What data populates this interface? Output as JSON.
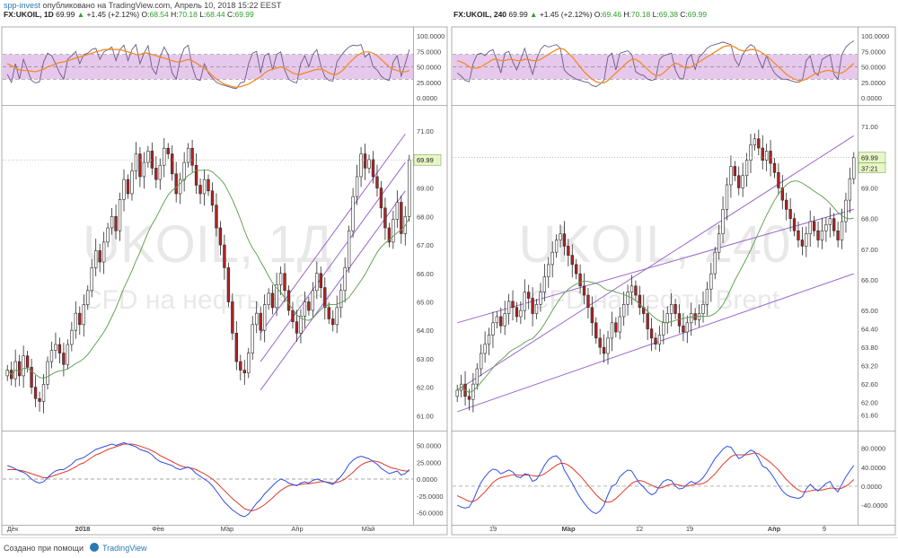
{
  "header": {
    "user": "spp-invest",
    "published_text": "опубликовано на TradingView.com, Апрель 10, 2018 15:22 EEST"
  },
  "footer": {
    "created_text": "Создано при помощи",
    "brand": "TradingView"
  },
  "colors": {
    "up": "#ffffff",
    "down": "#b22222",
    "wick": "#2a2a2a",
    "ma": "#5a9a4a",
    "channel": "#9966cc",
    "rsi_band": "#e6c8ec",
    "rsi_line": "#6b5a8a",
    "rsi_ma": "#f08c28",
    "macd_blue": "#2f4fe0",
    "macd_red": "#e0392b",
    "last_price_bg": "#e8f5c8"
  },
  "chart_data": [
    {
      "type": "candlestick",
      "symbol": "FX:UKOIL, 1D",
      "ohlc_line": {
        "symbol": "FX:UKOIL, 1D",
        "last": "69.99",
        "change": "+1.45 (+2.12%)",
        "O": "68.54",
        "H": "70.18",
        "L": "68.44",
        "C": "69.99"
      },
      "watermark": {
        "title": "UKOIL, 1Д",
        "subtitle": "CFD на нефть Brent"
      },
      "x_ticks": [
        "Дек",
        "2018",
        "Фев",
        "Мар",
        "Апр",
        "Май"
      ],
      "price_ticks": [
        "71.00",
        "70.00",
        "69.00",
        "68.00",
        "67.00",
        "66.00",
        "65.00",
        "64.00",
        "63.00",
        "62.00",
        "61.00"
      ],
      "ylim": [
        60.6,
        71.7
      ],
      "last_price_label": "69.99",
      "close": [
        62.6,
        62.3,
        62.9,
        62.4,
        63.1,
        62.7,
        62.0,
        61.6,
        61.5,
        62.1,
        62.9,
        63.3,
        63.5,
        63.2,
        62.8,
        63.5,
        64.0,
        64.6,
        64.2,
        64.9,
        65.4,
        66.2,
        66.8,
        66.4,
        67.1,
        67.6,
        68.0,
        67.5,
        68.6,
        69.3,
        68.8,
        69.6,
        70.2,
        69.4,
        69.9,
        70.3,
        69.7,
        69.3,
        69.8,
        70.4,
        70.2,
        69.5,
        68.8,
        69.3,
        69.9,
        70.4,
        69.8,
        69.1,
        68.8,
        69.3,
        68.9,
        68.4,
        67.6,
        67.0,
        66.2,
        65.0,
        63.9,
        62.9,
        62.6,
        62.5,
        63.2,
        64.2,
        64.6,
        64.0,
        64.9,
        65.3,
        64.8,
        65.6,
        66.0,
        65.4,
        64.7,
        64.3,
        63.9,
        64.5,
        65.0,
        64.7,
        65.4,
        66.0,
        65.5,
        64.8,
        64.4,
        64.2,
        64.8,
        65.4,
        66.2,
        67.5,
        68.7,
        69.4,
        70.2,
        69.7,
        70.0,
        69.4,
        69.0,
        68.3,
        67.6,
        67.1,
        67.9,
        68.5,
        67.4,
        68.0,
        69.99
      ],
      "ma_period": 20,
      "channel_lines": [
        {
          "x": [
            0,
            0
          ],
          "y": [
            0,
            0
          ]
        }
      ],
      "channel": [
        [
          61.9,
          68.9
        ],
        [
          62.9,
          69.9
        ],
        [
          63.9,
          70.9
        ]
      ],
      "channel_x": [
        63,
        99
      ],
      "rsi": {
        "ticks": [
          "100.0000",
          "75.0000",
          "50.0000",
          "25.0000",
          "0.0000"
        ],
        "ylim": [
          0,
          100
        ],
        "band": [
          30,
          70
        ],
        "values": [
          38,
          25,
          55,
          30,
          62,
          45,
          28,
          24,
          26,
          58,
          72,
          68,
          55,
          40,
          30,
          62,
          68,
          75,
          55,
          70,
          72,
          78,
          80,
          62,
          74,
          78,
          82,
          60,
          78,
          85,
          60,
          78,
          86,
          55,
          72,
          84,
          48,
          38,
          66,
          82,
          70,
          40,
          30,
          62,
          80,
          85,
          50,
          30,
          28,
          55,
          40,
          32,
          25,
          22,
          20,
          18,
          16,
          15,
          24,
          26,
          55,
          72,
          75,
          40,
          68,
          72,
          45,
          70,
          74,
          45,
          30,
          26,
          24,
          55,
          68,
          50,
          70,
          78,
          52,
          34,
          28,
          27,
          58,
          68,
          76,
          82,
          85,
          84,
          86,
          66,
          72,
          50,
          45,
          35,
          30,
          28,
          58,
          68,
          35,
          55,
          78
        ],
        "ma": [
          55,
          52,
          48,
          45,
          44,
          44,
          43,
          42,
          44,
          46,
          50,
          52,
          55,
          57,
          58,
          60,
          62,
          64,
          66,
          68,
          70,
          72,
          74,
          76,
          78,
          78,
          78,
          78,
          78,
          76,
          74,
          72,
          70,
          70,
          72,
          72,
          70,
          68,
          66,
          64,
          62,
          60,
          58,
          58,
          60,
          62,
          60,
          56,
          52,
          48,
          42,
          36,
          30,
          26,
          22,
          20,
          18,
          17,
          18,
          20,
          22,
          26,
          30,
          34,
          40,
          44,
          46,
          48,
          50,
          48,
          44,
          40,
          38,
          38,
          40,
          42,
          44,
          46,
          46,
          44,
          40,
          38,
          38,
          42,
          48,
          56,
          62,
          68,
          72,
          74,
          74,
          72,
          68,
          62,
          56,
          50,
          46,
          44,
          42,
          42,
          44
        ]
      },
      "macd": {
        "ticks": [
          "50.0000",
          "25.0000",
          "0.0000",
          "-25.0000",
          "-50.0000"
        ],
        "ylim": [
          -60,
          60
        ],
        "blue": [
          20,
          18,
          15,
          12,
          10,
          6,
          0,
          -4,
          -6,
          -4,
          2,
          8,
          12,
          14,
          14,
          18,
          22,
          28,
          30,
          32,
          36,
          40,
          44,
          46,
          48,
          50,
          52,
          50,
          52,
          54,
          52,
          50,
          48,
          44,
          42,
          40,
          36,
          30,
          26,
          24,
          22,
          20,
          16,
          14,
          16,
          18,
          14,
          8,
          4,
          0,
          -4,
          -10,
          -18,
          -26,
          -34,
          -40,
          -46,
          -50,
          -54,
          -56,
          -52,
          -44,
          -36,
          -30,
          -22,
          -16,
          -10,
          -4,
          0,
          -2,
          -6,
          -8,
          -10,
          -6,
          -4,
          -6,
          -2,
          0,
          -2,
          -4,
          -6,
          -8,
          -2,
          4,
          12,
          22,
          28,
          32,
          34,
          32,
          30,
          26,
          22,
          16,
          12,
          8,
          10,
          12,
          6,
          8,
          14
        ],
        "red": [
          14,
          14,
          14,
          13,
          12,
          10,
          8,
          6,
          4,
          2,
          2,
          4,
          6,
          8,
          10,
          12,
          15,
          18,
          22,
          24,
          28,
          32,
          36,
          38,
          41,
          44,
          46,
          48,
          50,
          52,
          52,
          52,
          51,
          49,
          47,
          45,
          42,
          39,
          35,
          32,
          29,
          26,
          23,
          20,
          18,
          17,
          16,
          14,
          11,
          8,
          4,
          0,
          -5,
          -11,
          -17,
          -23,
          -29,
          -34,
          -39,
          -44,
          -46,
          -47,
          -45,
          -42,
          -38,
          -33,
          -28,
          -22,
          -17,
          -13,
          -10,
          -9,
          -9,
          -8,
          -7,
          -7,
          -6,
          -5,
          -4,
          -4,
          -5,
          -6,
          -5,
          -3,
          0,
          5,
          10,
          16,
          21,
          24,
          26,
          27,
          26,
          24,
          21,
          18,
          16,
          15,
          13,
          12,
          12
        ]
      }
    },
    {
      "type": "candlestick",
      "symbol": "FX:UKOIL, 240",
      "ohlc_line": {
        "symbol": "FX:UKOIL, 240",
        "last": "69.99",
        "change": "+1.45 (+2.12%)",
        "O": "69.46",
        "H": "70.18",
        "L": "69.38",
        "C": "69.99"
      },
      "watermark": {
        "title": "UKOIL, 240",
        "subtitle": "CFD на нефть Brent"
      },
      "x_ticks": [
        "19",
        "Мар",
        "12",
        "19",
        "Апр",
        "9"
      ],
      "price_ticks": [
        "71.00",
        "70.00",
        "69.00",
        "68.00",
        "67.00",
        "66.00",
        "65.00",
        "64.40",
        "63.80",
        "63.20",
        "62.60",
        "62.00",
        "61.60"
      ],
      "ylim": [
        61.2,
        71.5
      ],
      "last_price_label": "69.99",
      "secondary_label": "37:21",
      "close": [
        62.4,
        62.6,
        62.2,
        62.1,
        62.6,
        63.1,
        63.6,
        63.9,
        64.2,
        64.6,
        64.8,
        64.5,
        64.9,
        65.3,
        65.1,
        64.8,
        65.0,
        65.6,
        65.4,
        64.9,
        65.2,
        65.6,
        66.1,
        66.5,
        66.9,
        67.3,
        67.5,
        67.1,
        66.8,
        66.5,
        66.2,
        65.8,
        65.5,
        65.1,
        64.6,
        64.1,
        63.8,
        63.6,
        64.1,
        64.6,
        64.3,
        64.8,
        65.2,
        65.6,
        65.8,
        65.5,
        65.1,
        64.9,
        64.4,
        64.1,
        63.9,
        64.2,
        64.6,
        64.9,
        65.2,
        64.9,
        64.5,
        64.3,
        64.6,
        64.9,
        64.7,
        64.9,
        65.2,
        65.7,
        66.2,
        66.9,
        67.5,
        68.3,
        69.1,
        69.7,
        69.4,
        69.0,
        69.4,
        69.9,
        70.4,
        70.6,
        70.3,
        69.9,
        70.2,
        69.8,
        69.5,
        69.0,
        68.6,
        68.3,
        68.0,
        67.6,
        67.3,
        67.1,
        67.5,
        67.9,
        67.6,
        67.3,
        67.6,
        67.8,
        68.0,
        67.6,
        67.3,
        67.9,
        68.6,
        69.3,
        69.99
      ],
      "ma_period": 20,
      "channel": [
        [
          62.4,
          70.7
        ],
        [
          64.6,
          68.3
        ],
        [
          61.7,
          66.2
        ]
      ],
      "channel_x": [
        0,
        100
      ],
      "rsi": {
        "ticks": [
          "100.0000",
          "75.0000",
          "50.0000",
          "25.0000",
          "0.0000"
        ],
        "ylim": [
          0,
          100
        ],
        "band": [
          30,
          70
        ],
        "values": [
          40,
          35,
          28,
          26,
          55,
          70,
          72,
          68,
          75,
          78,
          60,
          40,
          72,
          75,
          58,
          45,
          62,
          80,
          58,
          38,
          62,
          78,
          85,
          82,
          84,
          86,
          80,
          45,
          38,
          34,
          30,
          28,
          26,
          25,
          20,
          18,
          22,
          28,
          66,
          72,
          45,
          72,
          74,
          76,
          70,
          42,
          38,
          36,
          30,
          28,
          30,
          62,
          68,
          70,
          72,
          45,
          32,
          30,
          62,
          70,
          46,
          66,
          72,
          80,
          84,
          86,
          88,
          90,
          88,
          86,
          62,
          52,
          70,
          80,
          86,
          82,
          62,
          48,
          68,
          52,
          40,
          34,
          30,
          30,
          28,
          26,
          25,
          28,
          60,
          68,
          42,
          36,
          62,
          66,
          70,
          38,
          30,
          70,
          82,
          88,
          92
        ],
        "ma": [
          60,
          58,
          55,
          50,
          48,
          48,
          50,
          54,
          58,
          62,
          62,
          60,
          60,
          62,
          62,
          60,
          60,
          62,
          62,
          60,
          60,
          62,
          66,
          70,
          74,
          78,
          80,
          78,
          72,
          66,
          58,
          50,
          42,
          36,
          30,
          26,
          24,
          24,
          28,
          34,
          40,
          46,
          52,
          58,
          62,
          62,
          58,
          52,
          46,
          40,
          36,
          36,
          40,
          46,
          52,
          56,
          54,
          50,
          48,
          50,
          54,
          58,
          62,
          66,
          70,
          74,
          78,
          82,
          84,
          84,
          82,
          78,
          76,
          76,
          78,
          78,
          76,
          72,
          68,
          62,
          56,
          50,
          44,
          38,
          34,
          30,
          28,
          28,
          30,
          34,
          38,
          40,
          42,
          44,
          44,
          42,
          40,
          40,
          44,
          50,
          56
        ]
      },
      "macd": {
        "ticks": [
          "80.0000",
          "40.0000",
          "0.0000",
          "-40.0000"
        ],
        "ylim": [
          -70,
          100
        ],
        "blue": [
          -40,
          -44,
          -46,
          -44,
          -30,
          -10,
          8,
          20,
          30,
          36,
          34,
          26,
          30,
          34,
          30,
          20,
          18,
          26,
          24,
          10,
          14,
          28,
          44,
          56,
          62,
          64,
          56,
          34,
          20,
          6,
          -10,
          -24,
          -36,
          -46,
          -54,
          -58,
          -52,
          -40,
          -18,
          0,
          4,
          20,
          28,
          34,
          32,
          18,
          6,
          -2,
          -12,
          -18,
          -14,
          0,
          10,
          14,
          12,
          0,
          -6,
          -4,
          4,
          10,
          6,
          10,
          18,
          30,
          44,
          58,
          68,
          78,
          84,
          82,
          70,
          58,
          62,
          70,
          76,
          72,
          58,
          42,
          38,
          28,
          16,
          2,
          -10,
          -18,
          -22,
          -24,
          -26,
          -22,
          -6,
          4,
          -4,
          -10,
          -2,
          6,
          10,
          -4,
          -12,
          4,
          20,
          32,
          44
        ],
        "red": [
          -20,
          -24,
          -28,
          -32,
          -32,
          -28,
          -20,
          -12,
          -2,
          8,
          14,
          18,
          20,
          22,
          24,
          24,
          23,
          23,
          24,
          22,
          21,
          22,
          26,
          32,
          38,
          44,
          48,
          48,
          44,
          38,
          30,
          22,
          12,
          2,
          -8,
          -18,
          -26,
          -32,
          -34,
          -32,
          -26,
          -18,
          -10,
          -2,
          6,
          10,
          12,
          10,
          6,
          2,
          -2,
          -4,
          -2,
          2,
          4,
          4,
          2,
          0,
          0,
          2,
          4,
          4,
          6,
          10,
          18,
          26,
          36,
          46,
          54,
          62,
          66,
          66,
          66,
          66,
          68,
          70,
          68,
          62,
          56,
          50,
          42,
          34,
          24,
          14,
          6,
          -2,
          -8,
          -12,
          -12,
          -10,
          -8,
          -8,
          -8,
          -6,
          -4,
          -4,
          -6,
          -4,
          0,
          6,
          14
        ]
      }
    }
  ]
}
